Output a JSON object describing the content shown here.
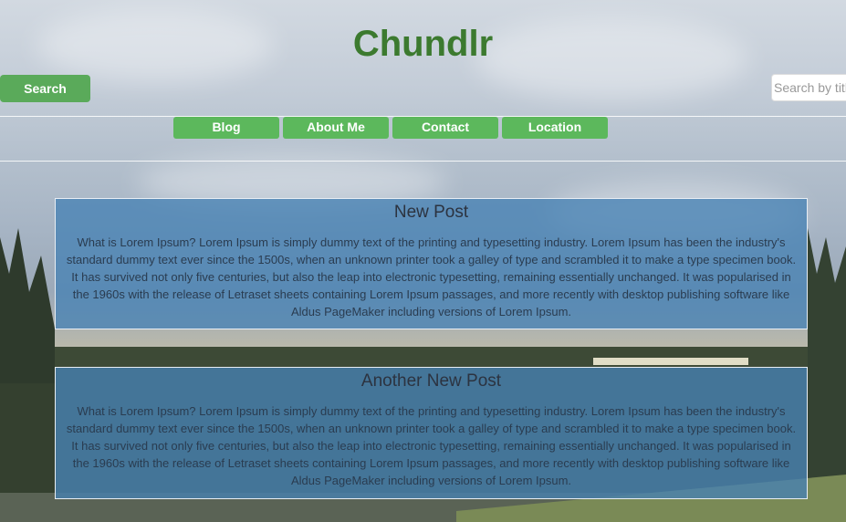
{
  "site": {
    "title": "Chundlr"
  },
  "search": {
    "button_label": "Search",
    "placeholder": "Search by title"
  },
  "nav": {
    "items": [
      {
        "label": "Blog"
      },
      {
        "label": "About Me"
      },
      {
        "label": "Contact"
      },
      {
        "label": "Location"
      }
    ]
  },
  "posts": [
    {
      "title": "New Post",
      "body": "What is Lorem Ipsum? Lorem Ipsum is simply dummy text of the printing and typesetting industry. Lorem Ipsum has been the industry's standard dummy text ever since the 1500s, when an unknown printer took a galley of type and scrambled it to make a type specimen book. It has survived not only five centuries, but also the leap into electronic typesetting, remaining essentially unchanged. It was popularised in the 1960s with the release of Letraset sheets containing Lorem Ipsum passages, and more recently with desktop publishing software like Aldus PageMaker including versions of Lorem Ipsum."
    },
    {
      "title": "Another New Post",
      "body": "What is Lorem Ipsum? Lorem Ipsum is simply dummy text of the printing and typesetting industry. Lorem Ipsum has been the industry's standard dummy text ever since the 1500s, when an unknown printer took a galley of type and scrambled it to make a type specimen book. It has survived not only five centuries, but also the leap into electronic typesetting, remaining essentially unchanged. It was popularised in the 1960s with the release of Letraset sheets containing Lorem Ipsum passages, and more recently with desktop publishing software like Aldus PageMaker including versions of Lorem Ipsum."
    }
  ],
  "colors": {
    "title": "#3c7a2f",
    "button": "#5cb85c",
    "post_bg": "#4682b4"
  }
}
